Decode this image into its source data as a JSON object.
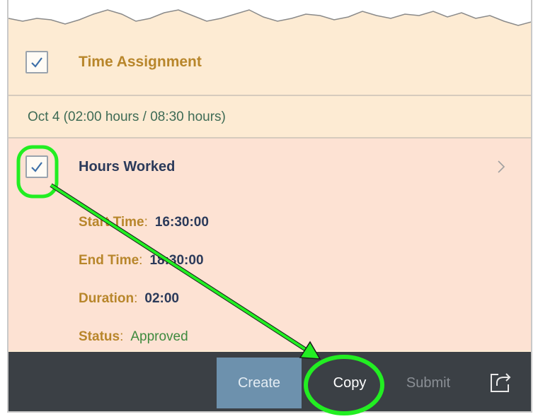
{
  "group": {
    "title": "Time Assignment",
    "checked": true
  },
  "day_header": "Oct 4 (02:00 hours / 08:30 hours)",
  "item": {
    "title": "Hours Worked",
    "checked": true,
    "fields": [
      {
        "label": "Start Time",
        "colon": ":",
        "value": "16:30:00"
      },
      {
        "label": "End Time",
        "colon": ":",
        "value": "18:30:00"
      },
      {
        "label": "Duration",
        "colon": ":",
        "value": "02:00"
      },
      {
        "label": "Status",
        "colon": ":",
        "value": "Approved"
      }
    ]
  },
  "footer": {
    "create_label": "Create",
    "copy_label": "Copy",
    "submit_label": "Submit"
  },
  "icons": {
    "checkmark": "checkmark-icon",
    "chevron": "chevron-right-icon",
    "share": "share-icon"
  },
  "colors": {
    "annotation": "#22ee22",
    "header_bg": "#fdebd3",
    "item_bg": "#fde2d3",
    "footer_bg": "#3b4045",
    "create_button": "#6d91ad"
  }
}
